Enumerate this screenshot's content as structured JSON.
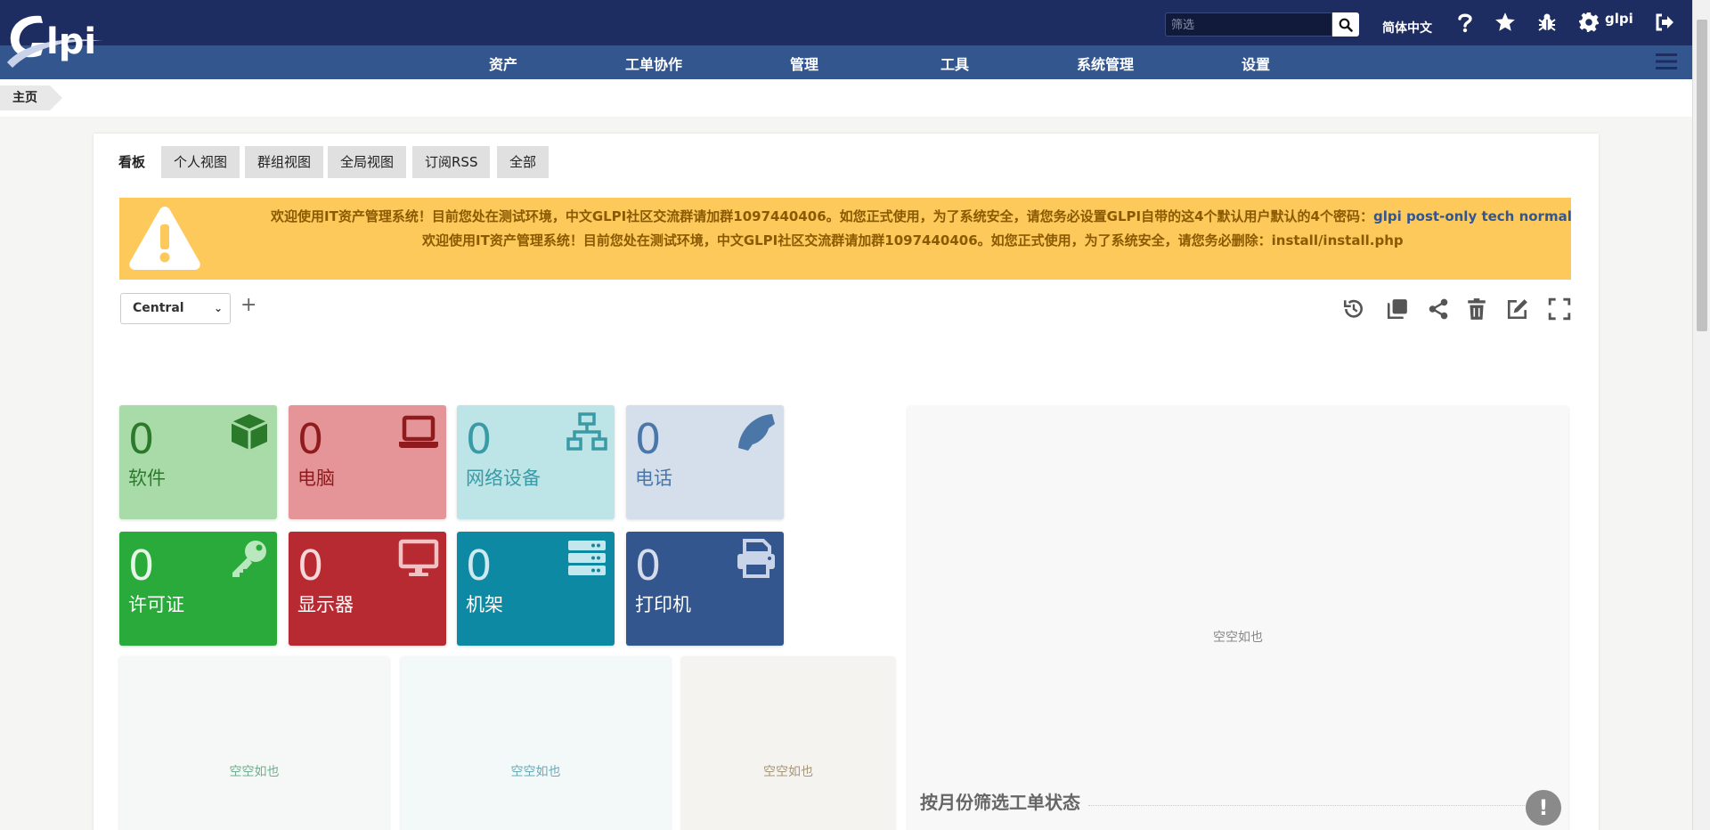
{
  "header": {
    "search_placeholder": "筛选",
    "language": "简体中文",
    "username": "glpi",
    "icons": [
      "search-icon",
      "help-icon",
      "star-icon",
      "bug-icon",
      "gear-icon",
      "logout-icon"
    ]
  },
  "menu": [
    "资产",
    "工单协作",
    "管理",
    "工具",
    "系统管理",
    "设置"
  ],
  "breadcrumb": "主页",
  "tabs": [
    "看板",
    "个人视图",
    "群组视图",
    "全局视图",
    "订阅RSS",
    "全部"
  ],
  "alert": {
    "line1": "欢迎使用IT资产管理系统！目前您处在测试环境，中文GLPI社区交流群请加群1097440406。如您正式使用，为了系统安全，请您务必设置GLPI自带的这4个默认用户默认的4个密码：",
    "line1_passwords": "glpi post-only tech normal",
    "line2": "欢迎使用IT资产管理系统！目前您处在测试环境，中文GLPI社区交流群请加群1097440406。如您正式使用，为了系统安全，请您务必删除：install/install.php"
  },
  "dashboard_select": "Central",
  "cards": [
    {
      "value": "0",
      "label": "软件",
      "icon": "cube-icon",
      "bg": "#a9dba9",
      "fg": "#2b7a2b"
    },
    {
      "value": "0",
      "label": "电脑",
      "icon": "laptop-icon",
      "bg": "#e59597",
      "fg": "#8f1b1f"
    },
    {
      "value": "0",
      "label": "网络设备",
      "icon": "network-icon",
      "bg": "#bde5e8",
      "fg": "#3a9aa6"
    },
    {
      "value": "0",
      "label": "电话",
      "icon": "phone-icon",
      "bg": "#d4dfeb",
      "fg": "#4a77a8"
    },
    {
      "value": "0",
      "label": "许可证",
      "icon": "key-icon",
      "bg": "#2aaa3a",
      "fg": "#ffffff"
    },
    {
      "value": "0",
      "label": "显示器",
      "icon": "monitor-icon",
      "bg": "#b82a31",
      "fg": "#ffffff"
    },
    {
      "value": "0",
      "label": "机架",
      "icon": "server-icon",
      "bg": "#0e89a3",
      "fg": "#ffffff"
    },
    {
      "value": "0",
      "label": "打印机",
      "icon": "printer-icon",
      "bg": "#33568f",
      "fg": "#ffffff"
    }
  ],
  "empty_text": "空空如也",
  "chart_title": "按月份筛选工单状态"
}
